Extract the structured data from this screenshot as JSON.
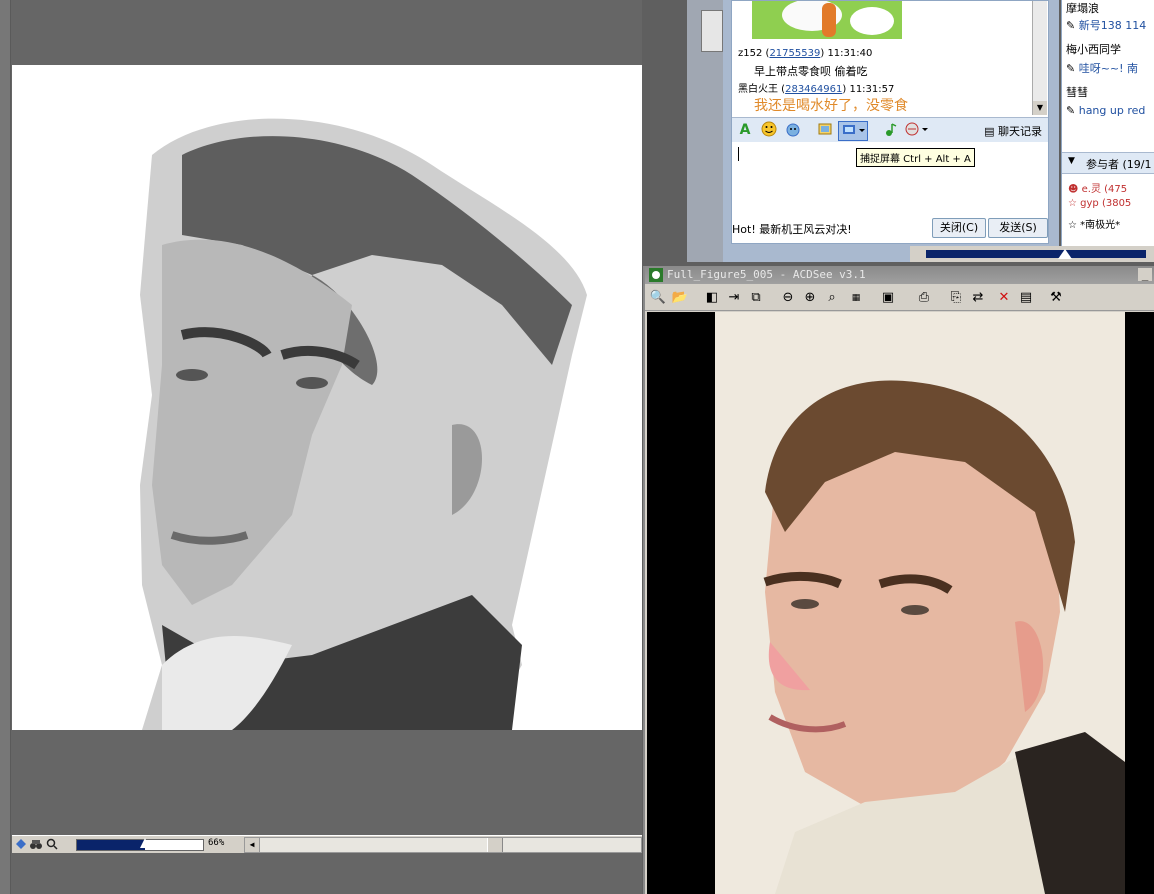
{
  "chat": {
    "messages": [
      {
        "sender": "z152",
        "uid": "21755539",
        "time": "11:31:40",
        "text": "早上带点零食呗  偷着吃",
        "color": "#000000"
      },
      {
        "sender": "黑白火王",
        "uid": "283464961",
        "time": "11:31:57",
        "text": "我还是喝水好了，没零食",
        "color": "#e08a2a"
      }
    ],
    "record_label": "聊天记录",
    "tooltip": "捕捉屏幕 Ctrl + Alt + A",
    "hot_text": "Hot! 最新机王风云对决!",
    "close_label": "关闭(C)",
    "send_label": "发送(S)"
  },
  "participants": {
    "top_items": [
      {
        "name": "摩塌浪",
        "signature": "新号138 114"
      },
      {
        "name": "梅小西同学",
        "signature": "哇呀~~! 南"
      },
      {
        "name": "彗彗",
        "signature": "hang up red"
      }
    ],
    "header": "参与者 (19/1",
    "members": [
      "e.灵 (475",
      "gyp (3805",
      "*南极光*"
    ]
  },
  "paint": {
    "zoom": "66%"
  },
  "viewer": {
    "title": "Full_Figure5_005 - ACDSee v3.1"
  }
}
